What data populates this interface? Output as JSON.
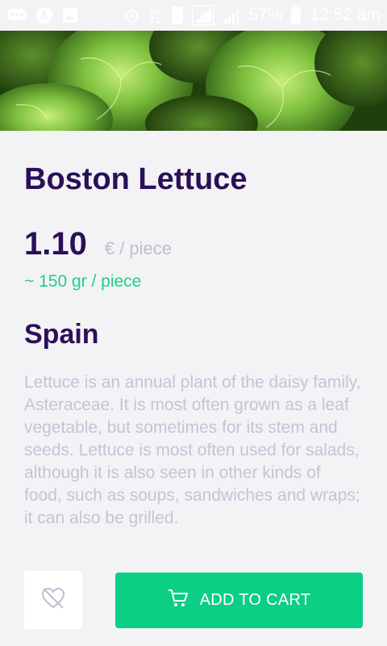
{
  "status_bar": {
    "icons": [
      "chat-icon",
      "a-icon",
      "image-icon",
      "alarm-icon",
      "signal-4g-icon",
      "sim-icon",
      "signal-icon",
      "signal-icon-2",
      "battery-icon"
    ],
    "battery": "57%",
    "time": "12:52 am"
  },
  "product": {
    "name": "Boston Lettuce",
    "price": "1.10",
    "unit": "€ / piece",
    "weight": "~ 150 gr / piece",
    "origin": "Spain",
    "description": "Lettuce is an annual plant of the daisy family, Asteraceae. It is most often grown as a leaf vegetable, but sometimes for its stem and seeds. Lettuce is most often used for salads, although it is also seen in other kinds of food, such as soups, sandwiches and wraps; it can also be grilled."
  },
  "actions": {
    "favorite_icon": "heart-off-icon",
    "cart_icon": "cart-icon",
    "add_to_cart_label": "ADD TO CART"
  },
  "colors": {
    "title": "#2b0f57",
    "accent": "#0bcf84",
    "muted": "#c7c2d6",
    "background": "#f3f3f5"
  }
}
